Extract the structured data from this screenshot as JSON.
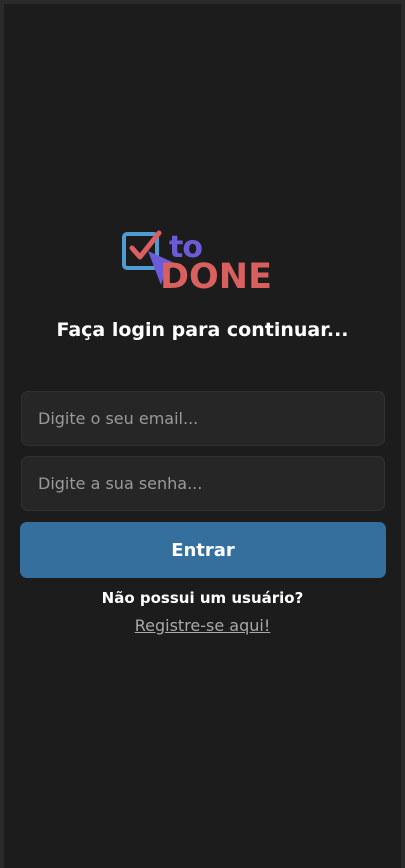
{
  "logo": {
    "line1": "to",
    "line2": "DONE",
    "icon": "checkbox-cursor-icon",
    "colors": {
      "box": "#4f9bd4",
      "check": "#d9605f",
      "cursor": "#6b5bd6"
    }
  },
  "heading": "Faça login para continuar...",
  "form": {
    "email_placeholder": "Digite o seu email...",
    "password_placeholder": "Digite a sua senha...",
    "submit_label": "Entrar"
  },
  "register": {
    "question": "Não possui um usuário?",
    "link_label": "Registre-se aqui!"
  },
  "colors": {
    "background": "#1c1c1c",
    "button": "#356f9e",
    "input_bg": "#262626"
  }
}
